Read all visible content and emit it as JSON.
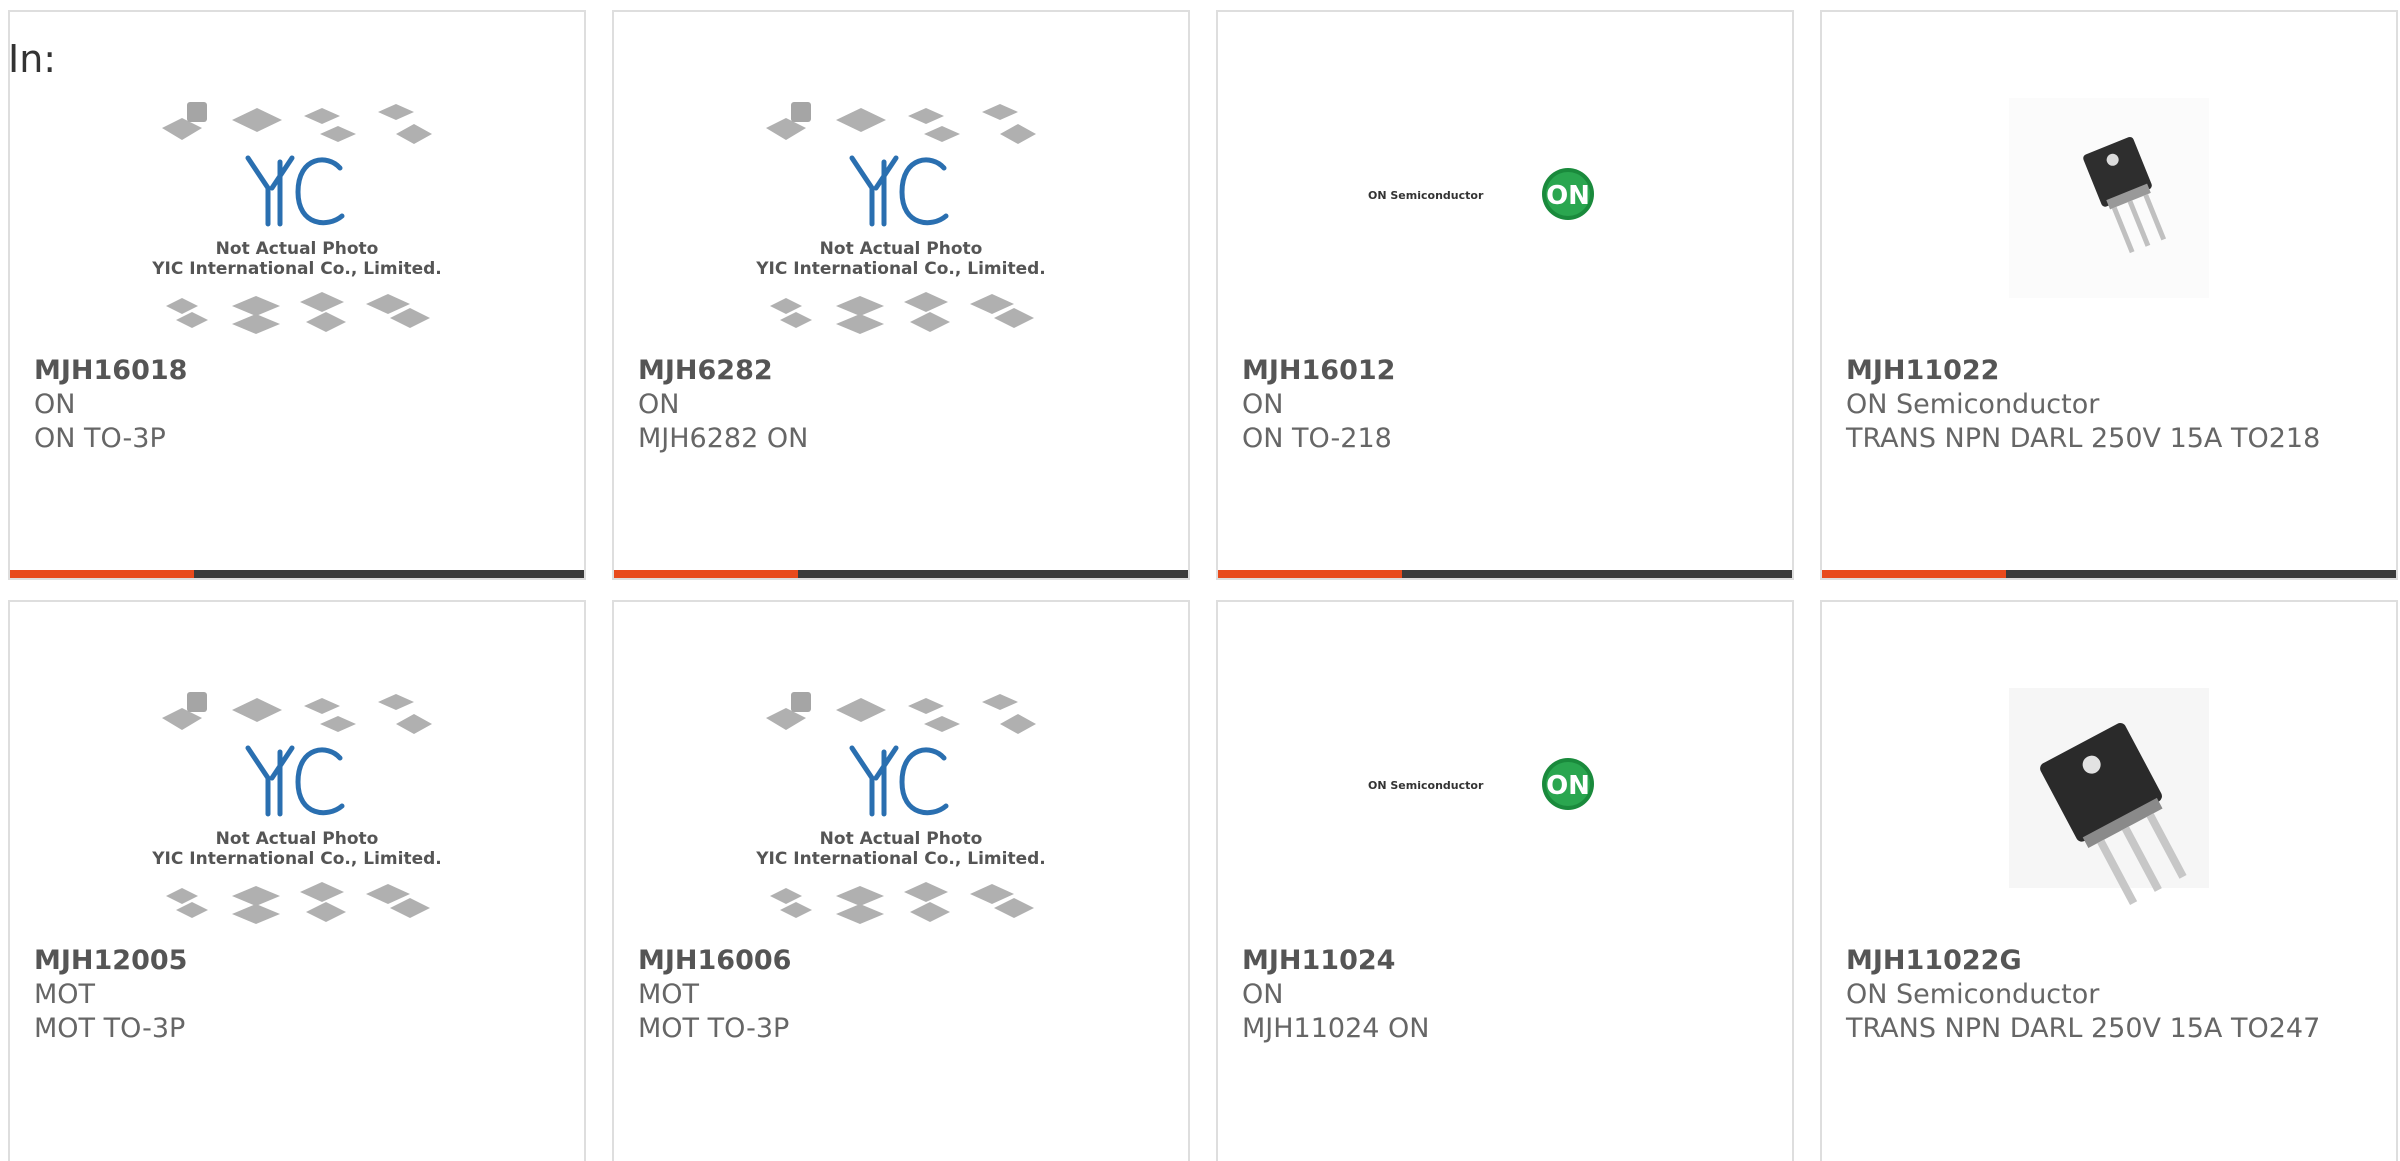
{
  "header": {
    "label": "In:"
  },
  "colors": {
    "accent": "#e84a1c",
    "bar": "#3b3b3b",
    "border": "#dedede",
    "text": "#666666"
  },
  "placeholder": {
    "logo_text": "YIC",
    "line1": "Not Actual Photo",
    "line2": "YIC International Co., Limited."
  },
  "on_logo": {
    "text": "ON Semiconductor",
    "badge": "ON"
  },
  "products": [
    {
      "part": "MJH16018",
      "mfr": "ON",
      "desc": "ON TO-3P",
      "image": "placeholder-icon"
    },
    {
      "part": "MJH6282",
      "mfr": "ON",
      "desc": "MJH6282 ON",
      "image": "placeholder-icon"
    },
    {
      "part": "MJH16012",
      "mfr": "ON",
      "desc": "ON TO-218",
      "image": "on-semiconductor-logo"
    },
    {
      "part": "MJH11022",
      "mfr": "ON Semiconductor",
      "desc": "TRANS NPN DARL 250V 15A TO218",
      "image": "transistor-photo-small"
    },
    {
      "part": "MJH12005",
      "mfr": "MOT",
      "desc": "MOT TO-3P",
      "image": "placeholder-icon"
    },
    {
      "part": "MJH16006",
      "mfr": "MOT",
      "desc": "MOT TO-3P",
      "image": "placeholder-icon"
    },
    {
      "part": "MJH11024",
      "mfr": "ON",
      "desc": "MJH11024 ON",
      "image": "on-semiconductor-logo"
    },
    {
      "part": "MJH11022G",
      "mfr": "ON Semiconductor",
      "desc": "TRANS NPN DARL 250V 15A TO247",
      "image": "transistor-photo-large"
    }
  ]
}
